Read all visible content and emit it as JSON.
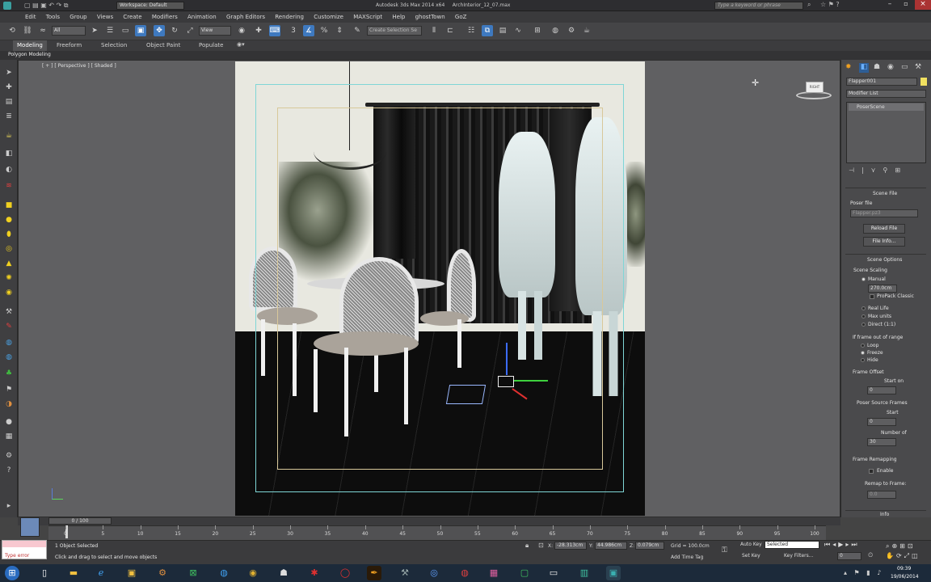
{
  "title_bar": {
    "workspace_label": "Workspace: Default",
    "window_title": "Autodesk 3ds Max 2014 x64     ArchInterior_12_07.max",
    "search_placeholder": "Type a keyword or phrase"
  },
  "menu": [
    "Edit",
    "Tools",
    "Group",
    "Views",
    "Create",
    "Modifiers",
    "Animation",
    "Graph Editors",
    "Rendering",
    "Customize",
    "MAXScript",
    "Help",
    "ghostTown",
    "GoZ"
  ],
  "toolbar": {
    "filter_value": "All",
    "view_value": "View",
    "selection_set_placeholder": "Create Selection Se"
  },
  "ribbon": {
    "tabs": [
      "Modeling",
      "Freeform",
      "Selection",
      "Object Paint",
      "Populate"
    ],
    "active_tab": "Modeling",
    "sub_label": "Polygon Modeling"
  },
  "viewport": {
    "label": "[ + ] [ Perspective ] [ Shaded ]"
  },
  "command_panel": {
    "object_name": "Flapper001",
    "modifier_list": "Modifier List",
    "stack_item": "PoserScene",
    "rollout_scene_file": "Scene File",
    "poser_file_label": "Poser file",
    "poser_file_value": "Flapper.pz3",
    "reload_button": "Reload File",
    "file_info_button": "File Info...",
    "rollout_scene_options": "Scene Options",
    "scene_scaling_label": "Scene Scaling",
    "manual_label": "Manual",
    "manual_value": "270.0cm",
    "propack_label": "ProPack Classic",
    "real_life_label": "Real Life",
    "max_units_label": "Max units",
    "direct_label": "Direct (1:1)",
    "out_of_range_label": "If frame out of range",
    "loop_label": "Loop",
    "freeze_label": "Freeze",
    "hide_label": "Hide",
    "frame_offset_label": "Frame Offset",
    "start_on_label": "Start on",
    "start_on_value": "0",
    "source_frames_label": "Poser Source Frames",
    "start_label": "Start",
    "start_value": "0",
    "number_of_label": "Number of",
    "number_of_value": "30",
    "frame_remapping_label": "Frame Remapping",
    "enable_label": "Enable",
    "remap_label": "Remap to Frame:",
    "remap_value": "0.0",
    "info_label": "Info"
  },
  "timeline": {
    "slider_label": "0 / 100",
    "ticks": [
      "0",
      "5",
      "10",
      "15",
      "20",
      "25",
      "30",
      "35",
      "40",
      "45",
      "50",
      "55",
      "60",
      "65",
      "70",
      "75",
      "80",
      "85",
      "90",
      "95",
      "100"
    ]
  },
  "status": {
    "maxscript_text": "Type error",
    "selection_text": "1 Object Selected",
    "prompt_text": "Click and drag to select and move objects",
    "x_label": "X:",
    "x_value": "-28.313cm",
    "y_label": "Y:",
    "y_value": "44.986cm",
    "z_label": "Z:",
    "z_value": "0.079cm",
    "grid_text": "Grid = 100.0cm",
    "add_time_tag": "Add Time Tag",
    "auto_key": "Auto Key",
    "set_key": "Set Key",
    "selected_dropdown": "Selected",
    "key_filters": "Key Filters...",
    "frame_value": "0"
  },
  "taskbar": {
    "time": "09:39",
    "date": "19/06/2014"
  }
}
